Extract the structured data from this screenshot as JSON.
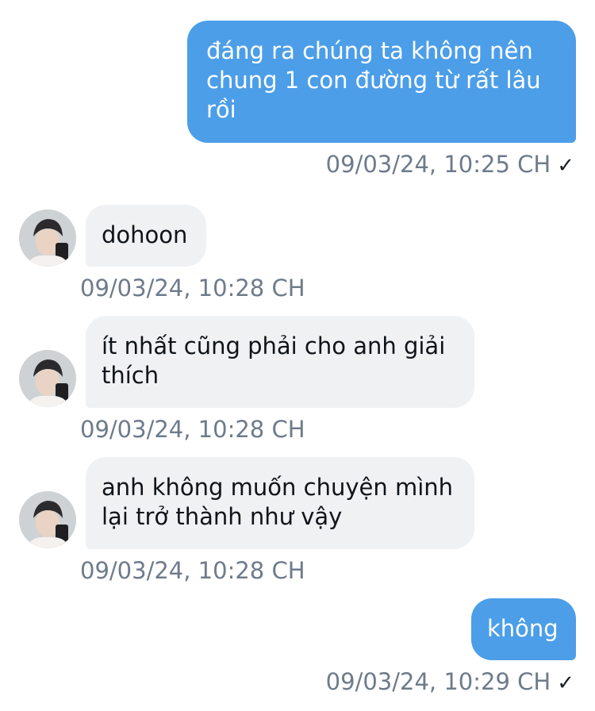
{
  "messages": [
    {
      "direction": "sent",
      "text": "đáng ra chúng ta không nên chung 1 con đường từ rất lâu rồi",
      "timestamp": "09/03/24, 10:25 CH",
      "status_icon": "check-icon",
      "status_glyph": "✓"
    },
    {
      "direction": "received",
      "text": "dohoon",
      "timestamp": "09/03/24, 10:28 CH"
    },
    {
      "direction": "received",
      "text": "ít nhất cũng phải cho anh giải thích",
      "timestamp": "09/03/24, 10:28 CH"
    },
    {
      "direction": "received",
      "text": "anh không muốn chuyện mình lại trở thành như vậy",
      "timestamp": "09/03/24, 10:28 CH"
    },
    {
      "direction": "sent",
      "text": "không",
      "timestamp": "09/03/24, 10:29 CH",
      "status_icon": "check-icon",
      "status_glyph": "✓"
    }
  ],
  "colors": {
    "sent_bubble": "#4c9ee8",
    "received_bubble": "#eff1f3",
    "timestamp": "#6e7b8b"
  }
}
